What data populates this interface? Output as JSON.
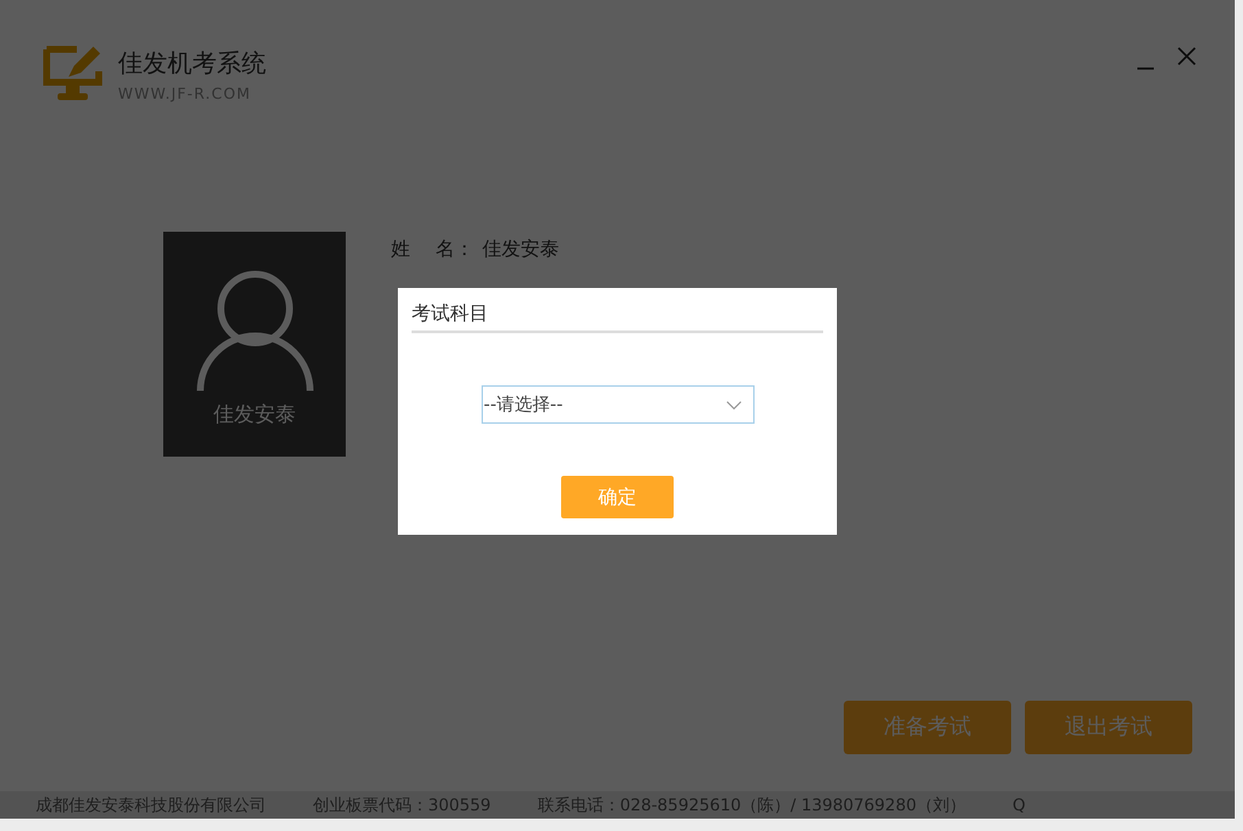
{
  "app": {
    "title": "佳发机考系统",
    "url": "WWW.JF-R.COM"
  },
  "profile": {
    "photo_caption": "佳发安泰",
    "fields": [
      {
        "label": "姓　 名：",
        "value": "佳发安泰"
      }
    ]
  },
  "actions": [
    "准备考试",
    "退出考试"
  ],
  "footer": [
    "成都佳发安泰科技股份有限公司",
    "创业板票代码：300559",
    "联系电话：028-85925610（陈）/ 13980769280（刘）",
    "Q"
  ],
  "dialog": {
    "title": "考试科目",
    "select": {
      "value": "--请选择--"
    },
    "confirm": "确定"
  }
}
